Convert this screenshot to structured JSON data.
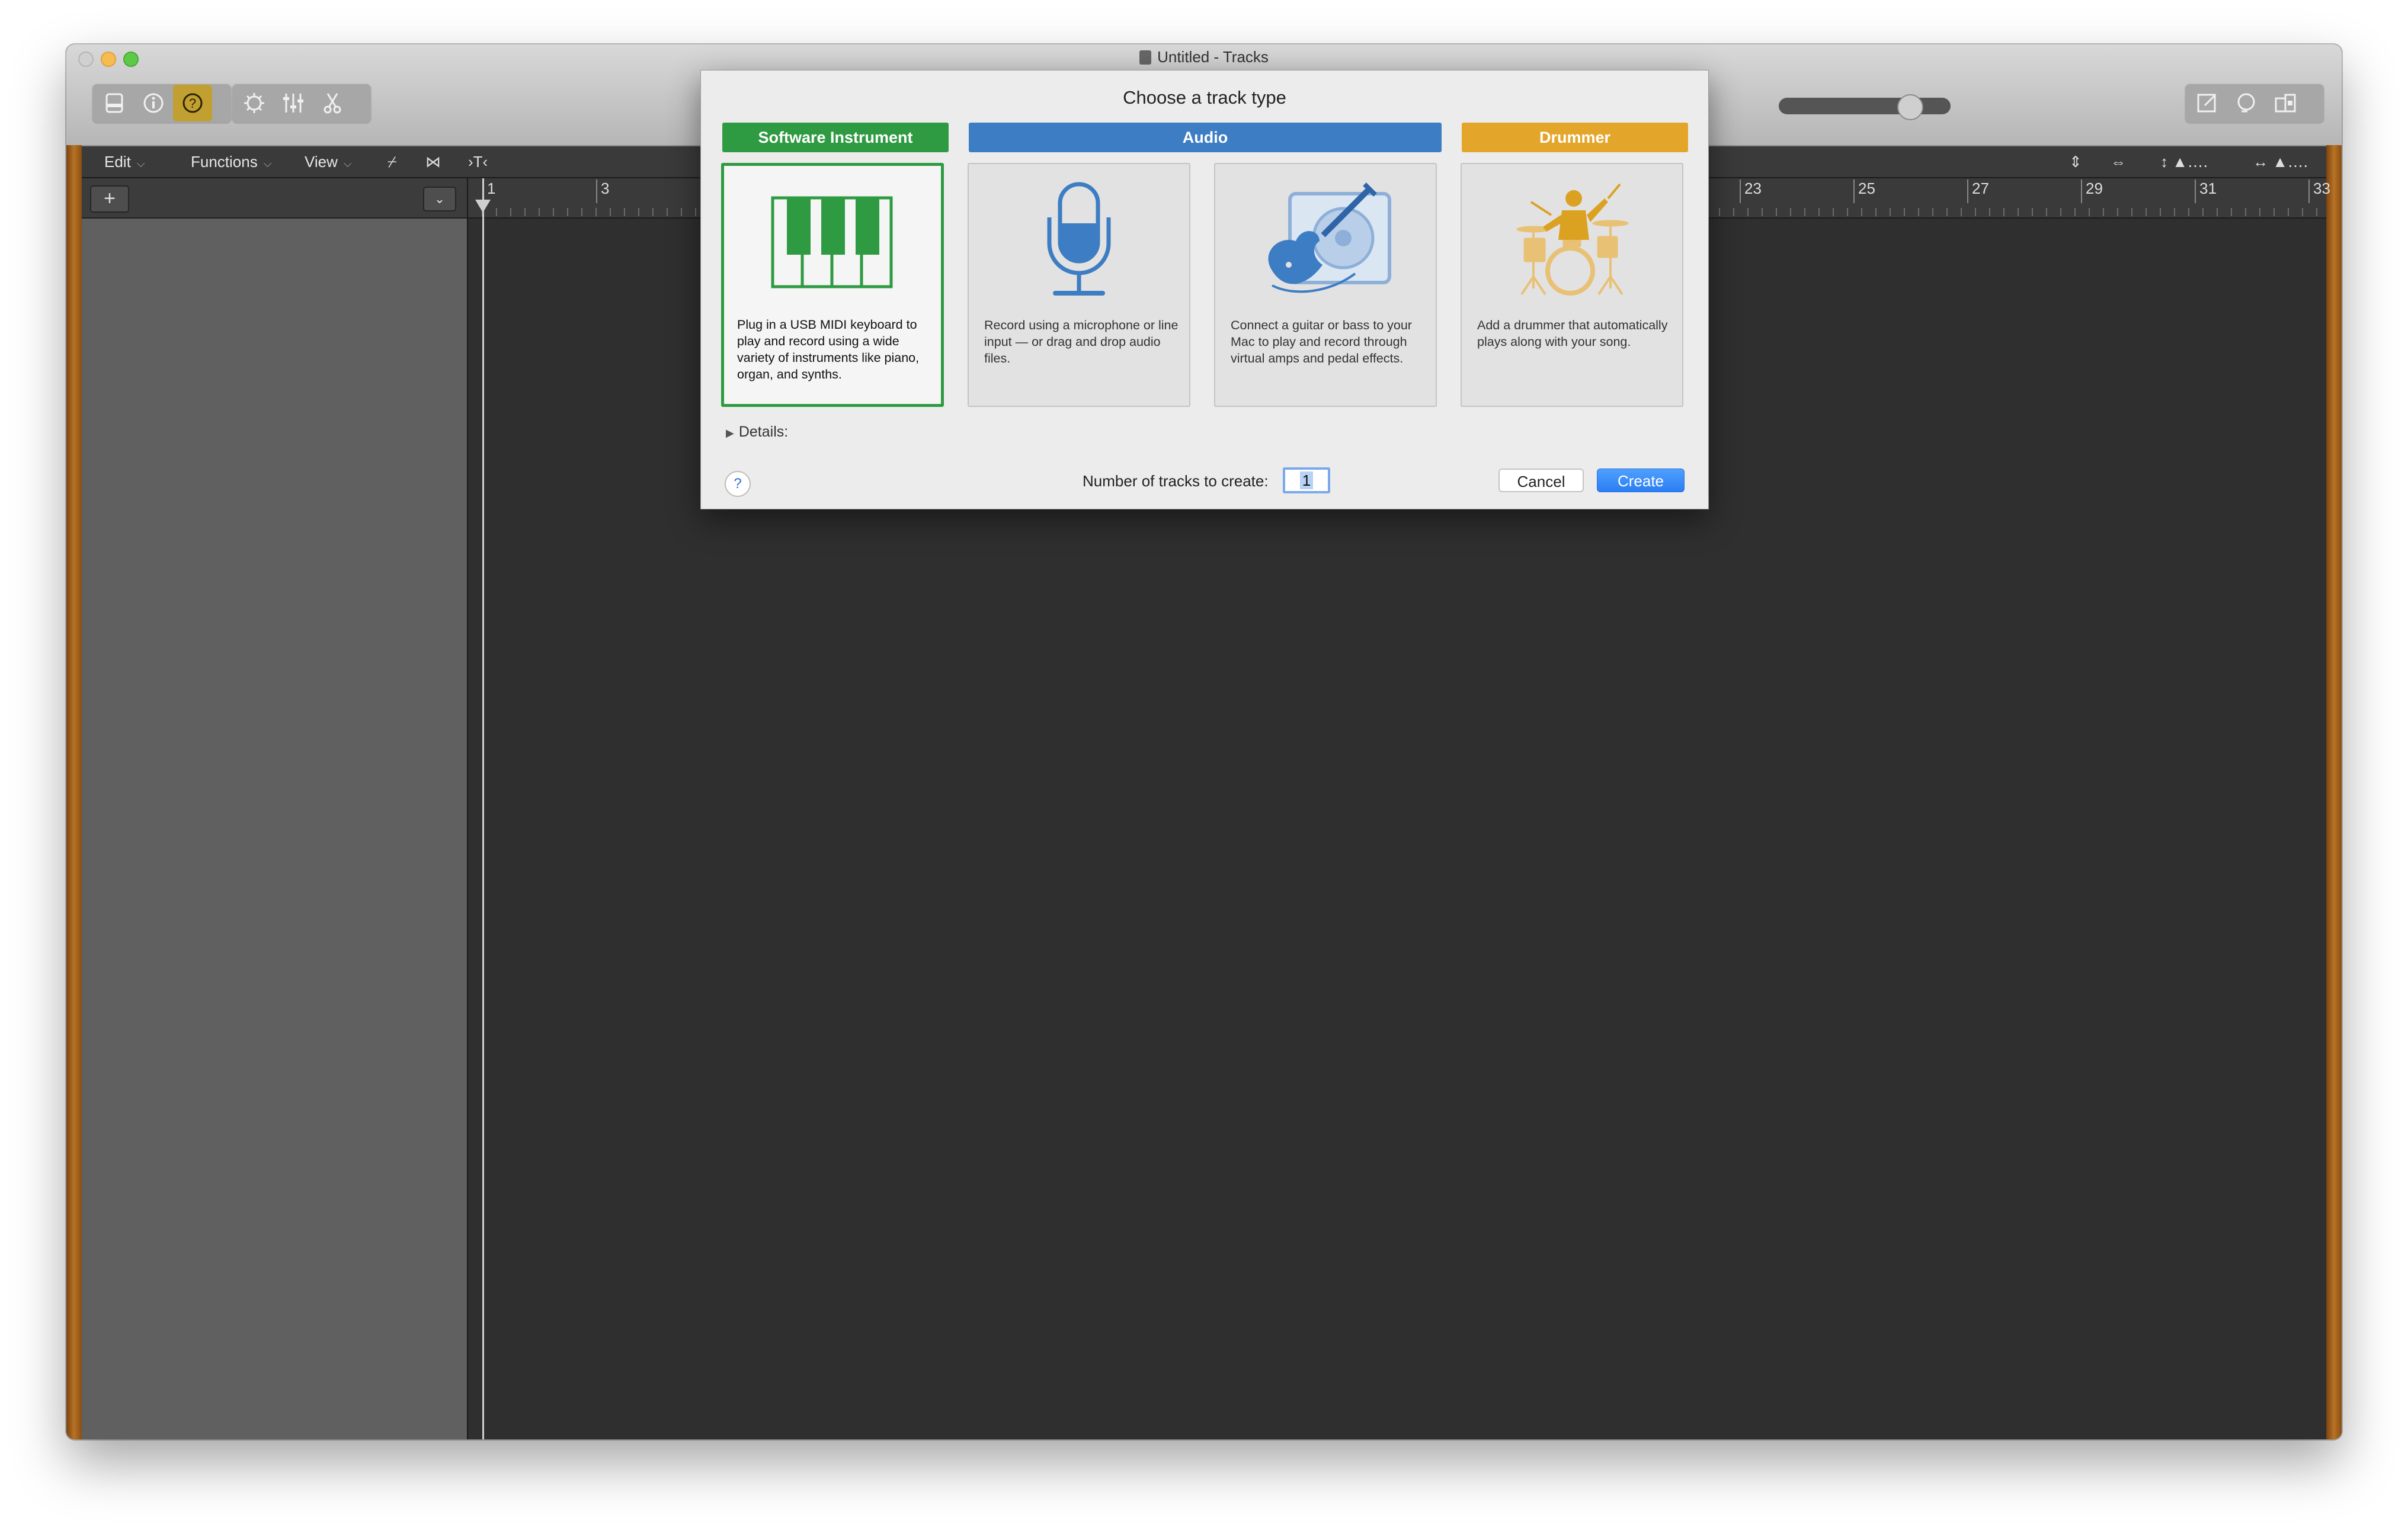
{
  "window": {
    "title": "Untitled - Tracks"
  },
  "toolbar": {
    "left_group1": [
      "library-icon",
      "info-icon",
      "help-icon"
    ],
    "left_group2": [
      "smart-controls-icon",
      "mixer-icon",
      "editors-icon"
    ],
    "right_group": [
      "notepad-icon",
      "loops-icon",
      "browser-icon"
    ]
  },
  "menubar": {
    "edit": "Edit",
    "functions": "Functions",
    "view": "View"
  },
  "ruler": {
    "bars": [
      "1",
      "3",
      "23",
      "25",
      "27",
      "29",
      "31",
      "33"
    ]
  },
  "dialog": {
    "title": "Choose a track type",
    "categories": {
      "software_instrument": "Software Instrument",
      "audio": "Audio",
      "drummer": "Drummer"
    },
    "colors": {
      "software_instrument": "#2e9a41",
      "audio": "#3d7dc3",
      "drummer": "#e3a62b"
    },
    "cards": [
      {
        "name": "software-instrument",
        "icon": "piano-keyboard-icon",
        "text": "Plug in a USB MIDI keyboard to play and record using a wide variety of instruments like piano, organ, and synths."
      },
      {
        "name": "audio-microphone",
        "icon": "microphone-icon",
        "text": "Record using a microphone or line input — or drag and drop audio files."
      },
      {
        "name": "audio-guitar",
        "icon": "guitar-amp-icon",
        "text": "Connect a guitar or bass to your Mac to play and record through virtual amps and pedal effects."
      },
      {
        "name": "drummer",
        "icon": "drummer-icon",
        "text": "Add a drummer that automatically plays along with your song."
      }
    ],
    "details_label": "Details:",
    "help": "?",
    "tracks_label": "Number of tracks to create:",
    "tracks_value": "1",
    "cancel": "Cancel",
    "create": "Create"
  }
}
